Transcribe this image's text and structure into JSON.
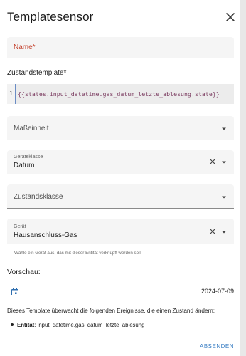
{
  "dialog": {
    "title": "Templatesensor",
    "close_icon": "close-icon"
  },
  "fields": {
    "name": {
      "label": "Name*",
      "value": ""
    },
    "state_template_label": "Zustandstemplate*",
    "template": {
      "line_number": "1",
      "code": "{{states.input_datetime.gas_datum_letzte_ablesung.state}}"
    },
    "unit": {
      "label": "Maßeinheit"
    },
    "device_class": {
      "label": "Geräteklasse",
      "value": "Datum"
    },
    "state_class": {
      "label": "Zustandsklasse"
    },
    "device": {
      "label": "Gerät",
      "value": "Hausanschluss-Gas",
      "helper": "Wähle ein Gerät aus, das mit dieser Entität verknüpft werden soll."
    }
  },
  "preview": {
    "title": "Vorschau:",
    "value": "2024-07-09",
    "icon": "calendar-icon",
    "events_text": "Dieses Template überwacht die folgenden Ereignisse, die einen Zustand ändern:",
    "entity_label": "Entität",
    "entity_value": ": input_datetime.gas_datum_letzte_ablesung"
  },
  "actions": {
    "button_label": "ABSENDEN"
  },
  "colors": {
    "accent": "#3b7fc4",
    "error": "#c4432f"
  }
}
